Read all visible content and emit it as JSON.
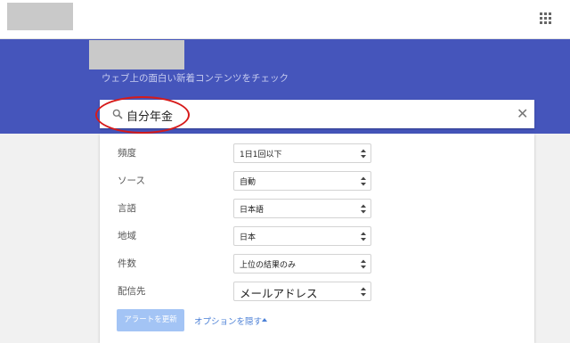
{
  "header": {
    "apps_icon": "apps-grid-icon"
  },
  "banner": {
    "tagline": "ウェブ上の面白い新着コンテンツをチェック"
  },
  "search": {
    "query": "自分年金",
    "search_icon": "search-icon",
    "clear_icon": "close-icon"
  },
  "options": {
    "rows": [
      {
        "label": "頻度",
        "value": "1日1回以下"
      },
      {
        "label": "ソース",
        "value": "自動"
      },
      {
        "label": "言語",
        "value": "日本語"
      },
      {
        "label": "地域",
        "value": "日本"
      },
      {
        "label": "件数",
        "value": "上位の結果のみ"
      },
      {
        "label": "配信先",
        "value": "メールアドレス"
      }
    ],
    "create_button": "アラートを更新",
    "hide_options_link": "オプションを隠す"
  },
  "colors": {
    "banner": "#4555bb",
    "annotation": "#d61b1b",
    "link": "#4a7fd6",
    "button": "#a3c4f5"
  }
}
